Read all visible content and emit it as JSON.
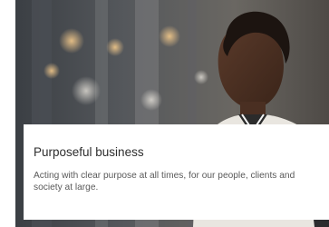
{
  "card": {
    "title": "Purposeful business",
    "description": "Acting with clear purpose at all times, for our people, clients and society at large."
  },
  "hero_image": {
    "icon": "hero-photo"
  }
}
